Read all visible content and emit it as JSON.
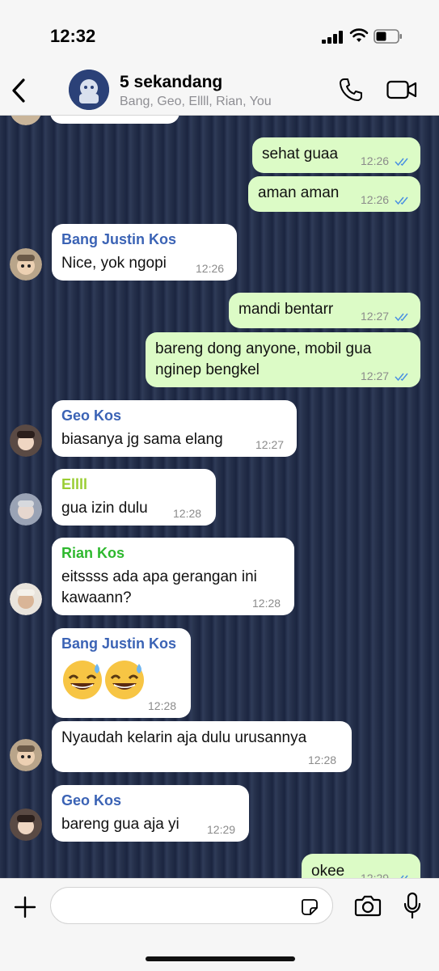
{
  "status": {
    "time": "12:32"
  },
  "header": {
    "title": "5 sekandang",
    "subtitle": "Bang, Geo, Ellll, Rian, You",
    "icons": [
      "chevron-left-icon",
      "group-avatar",
      "phone-icon",
      "video-camera-icon"
    ]
  },
  "colors": {
    "outgoing_bubble": "#dcfbc6",
    "incoming_bubble": "#ffffff",
    "read_ticks": "#4a90e2",
    "name_justin": "#3b63b5",
    "name_geo": "#3b63b5",
    "name_ellll": "#9acd32",
    "name_rian": "#2eb82e"
  },
  "messages": [
    {
      "dir": "out",
      "text": "sehat guaa",
      "time": "12:26",
      "read": true
    },
    {
      "dir": "out",
      "text": "aman aman",
      "time": "12:26",
      "read": true
    },
    {
      "dir": "in",
      "sender": "Bang Justin Kos",
      "text": "Nice, yok ngopi",
      "time": "12:26"
    },
    {
      "dir": "out",
      "text": "mandi bentarr",
      "time": "12:27",
      "read": true
    },
    {
      "dir": "out",
      "text_line1": "bareng dong anyone, mobil gua",
      "text_line2": "nginep bengkel",
      "time": "12:27",
      "read": true
    },
    {
      "dir": "in",
      "sender": "Geo Kos",
      "text": "biasanya jg sama elang",
      "time": "12:27"
    },
    {
      "dir": "in",
      "sender": "Ellll",
      "text": "gua izin dulu",
      "time": "12:28"
    },
    {
      "dir": "in",
      "sender": "Rian Kos",
      "text_line1": "eitssss ada apa gerangan ini",
      "text_line2": "kawaann?",
      "time": "12:28"
    },
    {
      "dir": "in",
      "sender": "Bang Justin Kos",
      "text": "😅😅",
      "time": "12:28"
    },
    {
      "dir": "in",
      "text": "Nyaudah kelarin aja dulu urusannya",
      "time": "12:28"
    },
    {
      "dir": "in",
      "sender": "Geo Kos",
      "text": "bareng gua aja yi",
      "time": "12:29"
    },
    {
      "dir": "out",
      "text": "okee",
      "time": "12:29",
      "read": true
    }
  ],
  "composer": {
    "placeholder": ""
  }
}
